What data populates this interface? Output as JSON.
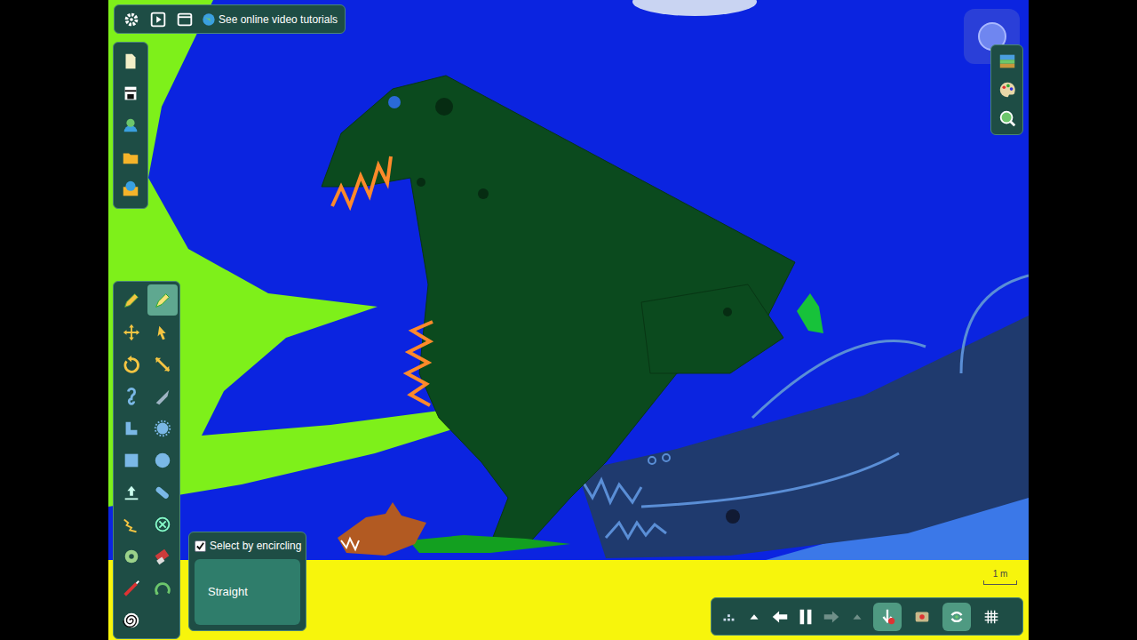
{
  "top_bar": {
    "tutorials_link": "See online video tutorials"
  },
  "tools": [
    {
      "selected": false
    },
    {
      "selected": true
    },
    {
      "selected": false
    },
    {
      "selected": false
    },
    {
      "selected": false
    },
    {
      "selected": false
    },
    {
      "selected": false
    },
    {
      "selected": false
    },
    {
      "selected": false
    },
    {
      "selected": false
    },
    {
      "selected": false
    },
    {
      "selected": false
    },
    {
      "selected": false
    },
    {
      "selected": false
    },
    {
      "selected": false
    },
    {
      "selected": false
    },
    {
      "selected": false
    },
    {
      "selected": false
    },
    {
      "selected": false
    },
    {
      "selected": false
    },
    {
      "selected": false
    }
  ],
  "tool_options": {
    "checkbox": {
      "label": "Select by encircling",
      "checked": true
    },
    "button": "Straight"
  },
  "scale_bar": "1 m",
  "simulation": {
    "playing": true,
    "redo_disabled": true
  },
  "toggles": [
    {
      "selected": true
    },
    {
      "selected": false
    },
    {
      "selected": true
    },
    {
      "selected": false
    }
  ]
}
